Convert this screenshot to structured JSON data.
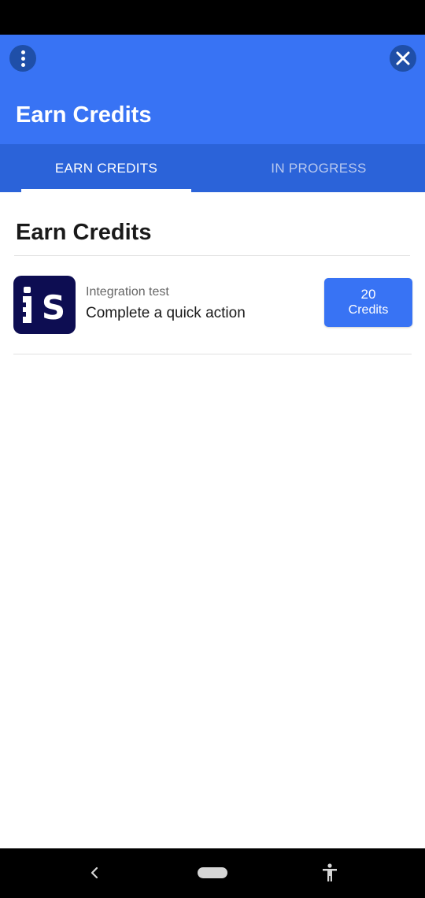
{
  "header": {
    "title": "Earn Credits",
    "menu_icon": "more-vertical-icon",
    "close_icon": "close-icon",
    "accent_color": "#3873f4"
  },
  "tabs": [
    {
      "label": "EARN CREDITS",
      "active": true
    },
    {
      "label": "IN PROGRESS",
      "active": false
    }
  ],
  "section": {
    "title": "Earn Credits"
  },
  "offers": [
    {
      "logo_icon": "integration-test-logo-icon",
      "logo_text": "iS",
      "name": "Integration test",
      "description": "Complete a quick action",
      "credits_amount": "20",
      "credits_unit": "Credits"
    }
  ],
  "nav_bar": {
    "back_icon": "back-chevron-icon",
    "home_icon": "home-pill-icon",
    "accessibility_icon": "accessibility-icon"
  }
}
